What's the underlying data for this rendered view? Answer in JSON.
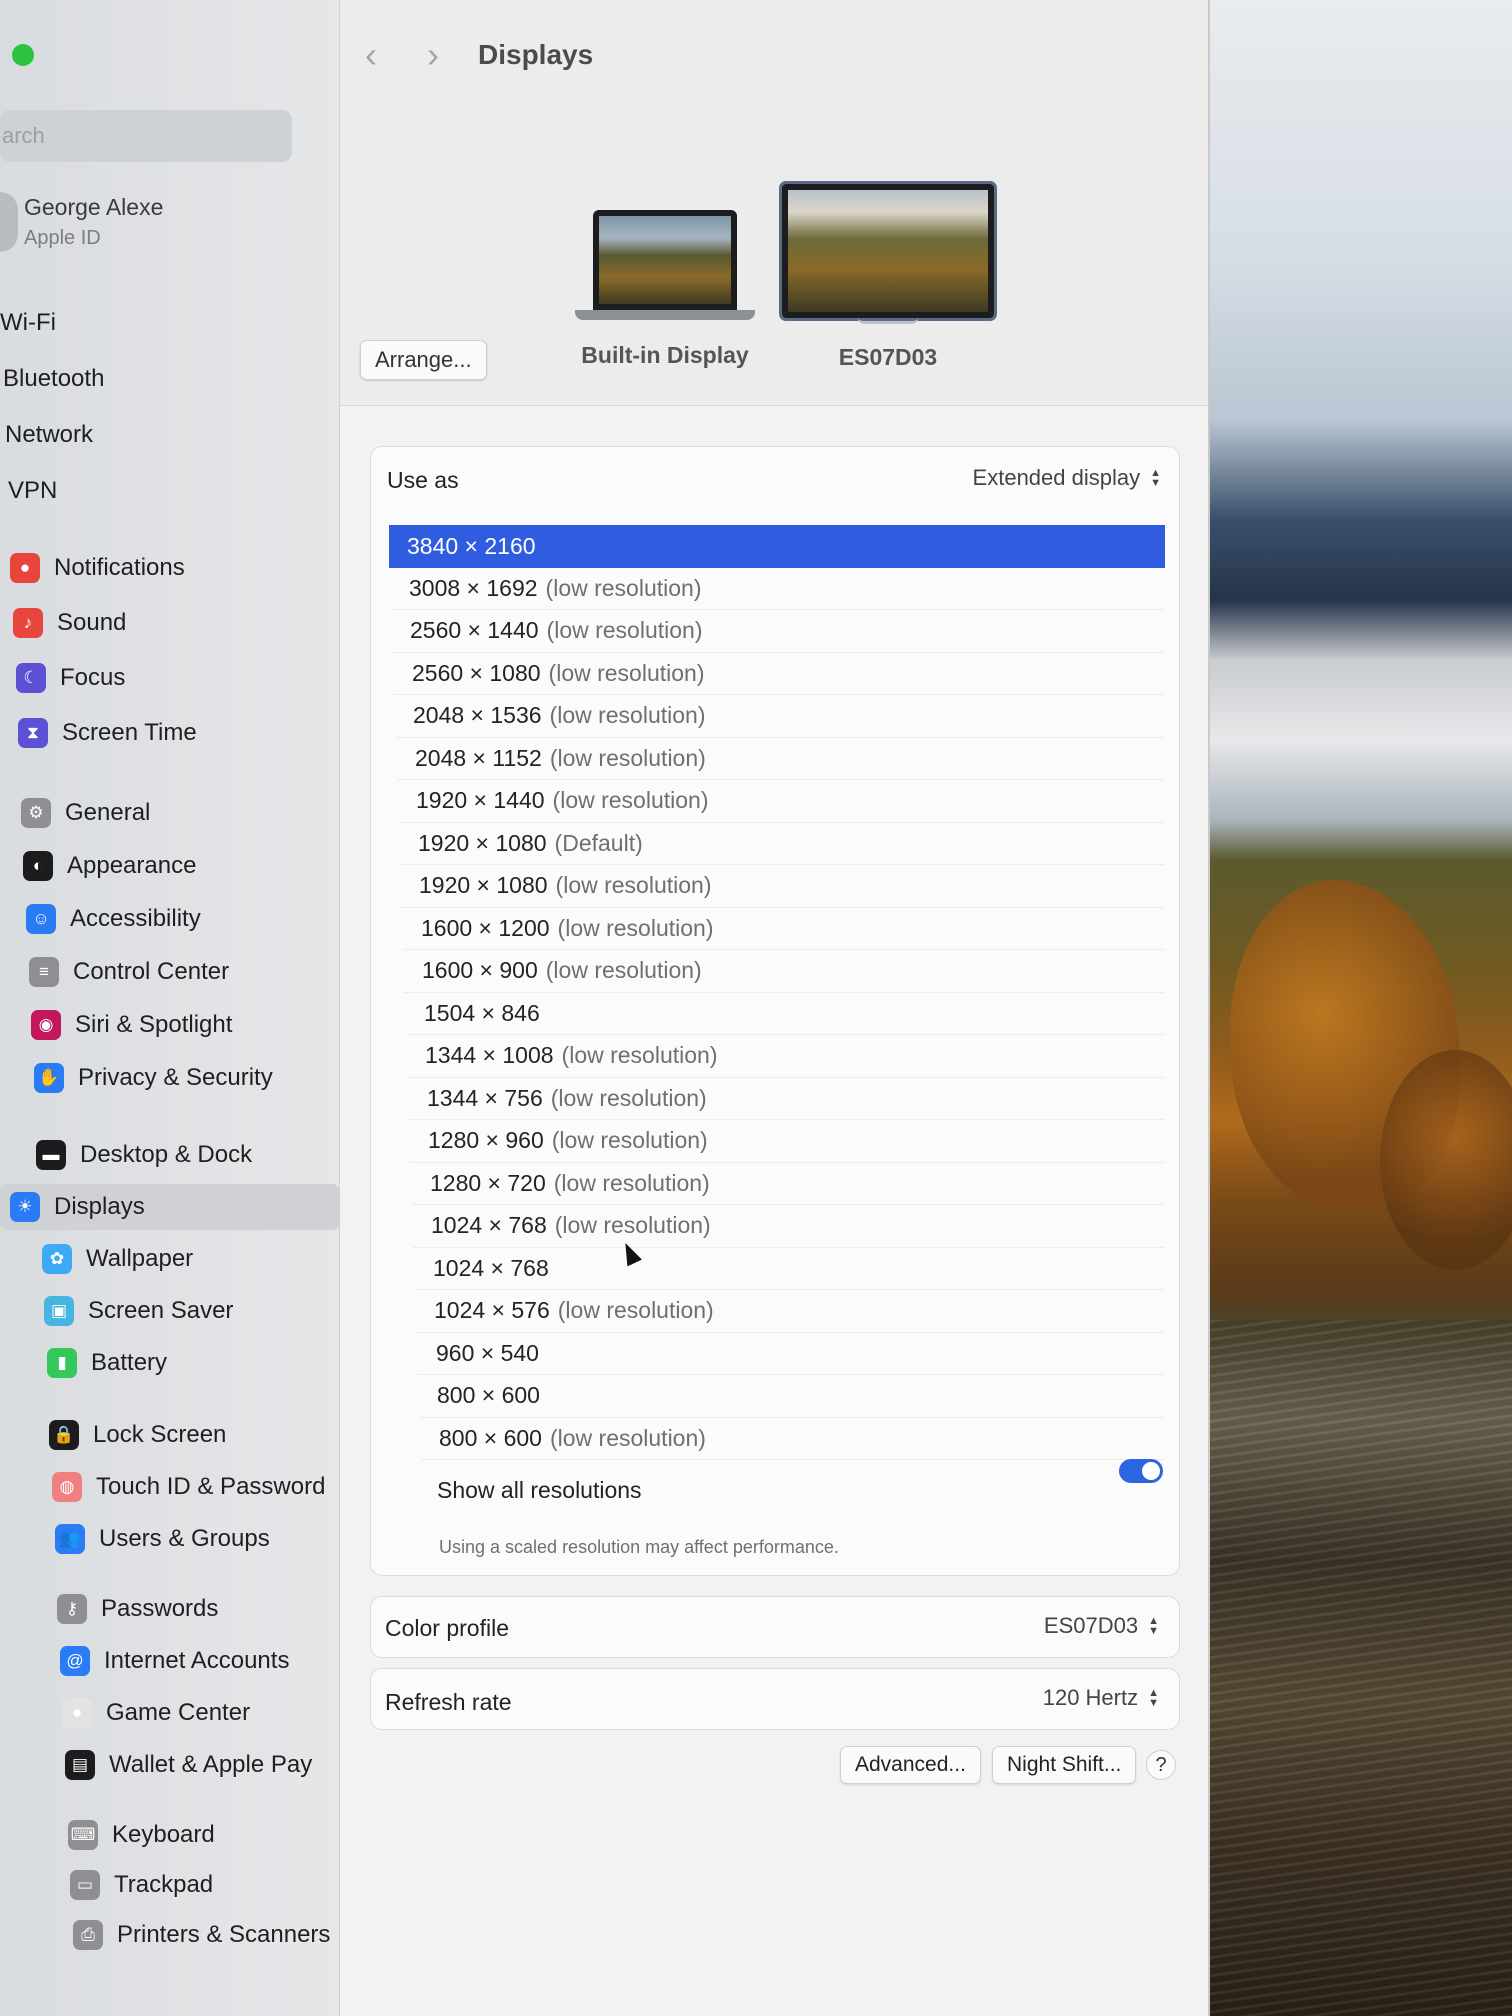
{
  "search": {
    "text": "arch"
  },
  "account": {
    "name": "George Alexe",
    "subtitle": "Apple ID"
  },
  "sidebar": {
    "items": [
      {
        "label": "Wi-Fi",
        "icon": "wifi-icon",
        "color": ""
      },
      {
        "label": "Bluetooth",
        "icon": "bluetooth-icon",
        "color": ""
      },
      {
        "label": "Network",
        "icon": "network-icon",
        "color": ""
      },
      {
        "label": "VPN",
        "icon": "vpn-icon",
        "color": ""
      },
      {
        "label": "Notifications",
        "icon": "notifications-icon",
        "color": "#e8453c"
      },
      {
        "label": "Sound",
        "icon": "sound-icon",
        "color": "#e8453c"
      },
      {
        "label": "Focus",
        "icon": "focus-icon",
        "color": "#5b50d6"
      },
      {
        "label": "Screen Time",
        "icon": "screen-time-icon",
        "color": "#5b50d6"
      },
      {
        "label": "General",
        "icon": "gear-icon",
        "color": "#8e8e93"
      },
      {
        "label": "Appearance",
        "icon": "appearance-icon",
        "color": "#1c1c1e"
      },
      {
        "label": "Accessibility",
        "icon": "accessibility-icon",
        "color": "#2a7bf6"
      },
      {
        "label": "Control Center",
        "icon": "control-center-icon",
        "color": "#8e8e93"
      },
      {
        "label": "Siri & Spotlight",
        "icon": "siri-icon",
        "color": "#c2185b"
      },
      {
        "label": "Privacy & Security",
        "icon": "hand-icon",
        "color": "#2a7bf6"
      },
      {
        "label": "Desktop & Dock",
        "icon": "dock-icon",
        "color": "#1c1c1e"
      },
      {
        "label": "Displays",
        "icon": "sun-icon",
        "color": "#2a7bf6"
      },
      {
        "label": "Wallpaper",
        "icon": "wallpaper-icon",
        "color": "#3fa9f5"
      },
      {
        "label": "Screen Saver",
        "icon": "screen-saver-icon",
        "color": "#46b6e0"
      },
      {
        "label": "Battery",
        "icon": "battery-icon",
        "color": "#34c759"
      },
      {
        "label": "Lock Screen",
        "icon": "lock-icon",
        "color": "#1c1c1e"
      },
      {
        "label": "Touch ID & Password",
        "icon": "fingerprint-icon",
        "color": "#f08080"
      },
      {
        "label": "Users & Groups",
        "icon": "users-icon",
        "color": "#2a7bf6"
      },
      {
        "label": "Passwords",
        "icon": "key-icon",
        "color": "#8e8e93"
      },
      {
        "label": "Internet Accounts",
        "icon": "at-icon",
        "color": "#2a7bf6"
      },
      {
        "label": "Game Center",
        "icon": "game-center-icon",
        "color": "#e3e3e3"
      },
      {
        "label": "Wallet & Apple Pay",
        "icon": "wallet-icon",
        "color": "#1c1c1e"
      },
      {
        "label": "Keyboard",
        "icon": "keyboard-icon",
        "color": "#8e8e93"
      },
      {
        "label": "Trackpad",
        "icon": "trackpad-icon",
        "color": "#8e8e93"
      },
      {
        "label": "Printers & Scanners",
        "icon": "printer-icon",
        "color": "#8e8e93"
      }
    ],
    "selected": "Displays"
  },
  "header": {
    "title": "Displays",
    "back": "‹",
    "forward": "›"
  },
  "arrange_label": "Arrange...",
  "displays": [
    {
      "label": "Built-in Display",
      "selected": false
    },
    {
      "label": "ES07D03",
      "selected": true
    }
  ],
  "use_as": {
    "label": "Use as",
    "value": "Extended display"
  },
  "resolutions": [
    {
      "res": "3840 × 2160",
      "note": "",
      "selected": true
    },
    {
      "res": "3008 × 1692",
      "note": "(low resolution)"
    },
    {
      "res": "2560 × 1440",
      "note": "(low resolution)"
    },
    {
      "res": "2560 × 1080",
      "note": "(low resolution)"
    },
    {
      "res": "2048 × 1536",
      "note": "(low resolution)"
    },
    {
      "res": "2048 × 1152",
      "note": "(low resolution)"
    },
    {
      "res": "1920 × 1440",
      "note": "(low resolution)"
    },
    {
      "res": "1920 × 1080",
      "note": "(Default)"
    },
    {
      "res": "1920 × 1080",
      "note": "(low resolution)"
    },
    {
      "res": "1600 × 1200",
      "note": "(low resolution)"
    },
    {
      "res": "1600 × 900",
      "note": "(low resolution)"
    },
    {
      "res": "1504 × 846",
      "note": ""
    },
    {
      "res": "1344 × 1008",
      "note": "(low resolution)"
    },
    {
      "res": "1344 × 756",
      "note": "(low resolution)"
    },
    {
      "res": "1280 × 960",
      "note": "(low resolution)"
    },
    {
      "res": "1280 × 720",
      "note": "(low resolution)"
    },
    {
      "res": "1024 × 768",
      "note": "(low resolution)"
    },
    {
      "res": "1024 × 768",
      "note": ""
    },
    {
      "res": "1024 × 576",
      "note": "(low resolution)"
    },
    {
      "res": "960 × 540",
      "note": ""
    },
    {
      "res": "800 × 600",
      "note": ""
    },
    {
      "res": "800 × 600",
      "note": "(low resolution)"
    }
  ],
  "show_all": {
    "label": "Show all resolutions",
    "enabled": true
  },
  "hint": "Using a scaled resolution may affect performance.",
  "color_profile": {
    "label": "Color profile",
    "value": "ES07D03"
  },
  "refresh_rate": {
    "label": "Refresh rate",
    "value": "120 Hertz"
  },
  "buttons": {
    "advanced": "Advanced...",
    "night_shift": "Night Shift...",
    "help": "?"
  },
  "colors": {
    "accent": "#2f5ce0",
    "toggle": "#2a66e0"
  }
}
